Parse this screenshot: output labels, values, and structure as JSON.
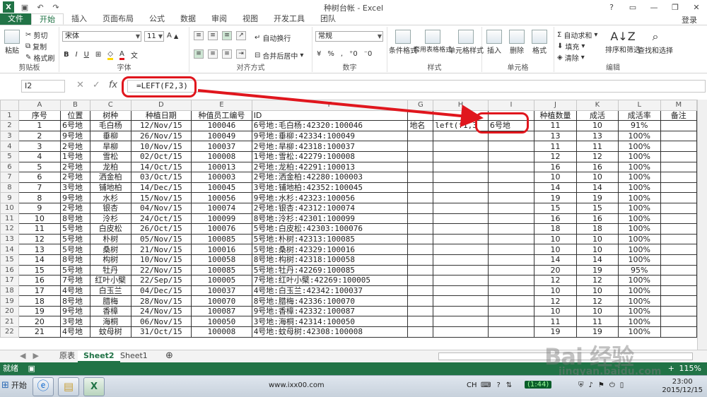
{
  "window": {
    "title": "种树台帐 - Excel",
    "login": "登录",
    "logo": "X"
  },
  "ribbon_tabs": [
    "文件",
    "开始",
    "插入",
    "页面布局",
    "公式",
    "数据",
    "审阅",
    "视图",
    "开发工具",
    "团队"
  ],
  "ribbon": {
    "clipboard": {
      "paste": "粘贴",
      "cut": "剪切",
      "copy": "复制",
      "format_painter": "格式刷",
      "label": "剪贴板"
    },
    "font": {
      "name": "宋体",
      "size": "11",
      "label": "字体"
    },
    "alignment": {
      "wrap": "自动换行",
      "merge": "合并后居中",
      "label": "对齐方式"
    },
    "number": {
      "format": "常规",
      "label": "数字"
    },
    "styles": {
      "conditional": "条件格式",
      "table": "套用表格格式",
      "cell_styles": "单元格样式",
      "label": "样式"
    },
    "cells": {
      "insert": "插入",
      "delete": "删除",
      "format": "格式",
      "label": "单元格"
    },
    "editing": {
      "autosum": "自动求和",
      "fill": "填充",
      "clear": "清除",
      "sort": "排序和筛选",
      "find": "查找和选择",
      "label": "编辑"
    }
  },
  "formula_bar": {
    "name_box": "I2",
    "formula": "=LEFT(F2,3)",
    "fx": "fx"
  },
  "columns": [
    "A",
    "B",
    "C",
    "D",
    "E",
    "F",
    "G",
    "H",
    "I",
    "J",
    "K",
    "L",
    "M"
  ],
  "header_row": [
    "序号",
    "位置",
    "树种",
    "种植日期",
    "种值员工编号",
    "ID",
    "",
    "",
    "",
    "种植数量",
    "成活",
    "成活率",
    "备注"
  ],
  "row2_extra": {
    "g": "地名",
    "h": "left(f1,3",
    "i": "6号地"
  },
  "rows": [
    [
      "1",
      "6号地",
      "毛白杨",
      "12/Nov/15",
      "100046",
      "6号地:毛白杨:42320:100046",
      "11",
      "10",
      "91%"
    ],
    [
      "2",
      "9号地",
      "垂柳",
      "26/Nov/15",
      "100049",
      "9号地:垂柳:42334:100049",
      "13",
      "13",
      "100%"
    ],
    [
      "3",
      "2号地",
      "旱柳",
      "10/Nov/15",
      "100037",
      "2号地:旱柳:42318:100037",
      "11",
      "11",
      "100%"
    ],
    [
      "4",
      "1号地",
      "雪松",
      "02/Oct/15",
      "100008",
      "1号地:雪松:42279:100008",
      "12",
      "12",
      "100%"
    ],
    [
      "5",
      "2号地",
      "龙柏",
      "14/Oct/15",
      "100013",
      "2号地:龙柏:42291:100013",
      "16",
      "16",
      "100%"
    ],
    [
      "6",
      "2号地",
      "洒金柏",
      "03/Oct/15",
      "100003",
      "2号地:洒金柏:42280:100003",
      "10",
      "10",
      "100%"
    ],
    [
      "7",
      "3号地",
      "铺地柏",
      "14/Dec/15",
      "100045",
      "3号地:铺地柏:42352:100045",
      "14",
      "14",
      "100%"
    ],
    [
      "8",
      "9号地",
      "水杉",
      "15/Nov/15",
      "100056",
      "9号地:水杉:42323:100056",
      "19",
      "19",
      "100%"
    ],
    [
      "9",
      "2号地",
      "银杏",
      "04/Nov/15",
      "100074",
      "2号地:银杏:42312:100074",
      "15",
      "15",
      "100%"
    ],
    [
      "10",
      "8号地",
      "泠杉",
      "24/Oct/15",
      "100099",
      "8号地:泠杉:42301:100099",
      "16",
      "16",
      "100%"
    ],
    [
      "11",
      "5号地",
      "白皮松",
      "26/Oct/15",
      "100076",
      "5号地:白皮松:42303:100076",
      "18",
      "18",
      "100%"
    ],
    [
      "12",
      "5号地",
      "朴树",
      "05/Nov/15",
      "100085",
      "5号地:朴树:42313:100085",
      "10",
      "10",
      "100%"
    ],
    [
      "13",
      "5号地",
      "桑树",
      "21/Nov/15",
      "100016",
      "5号地:桑树:42329:100016",
      "10",
      "10",
      "100%"
    ],
    [
      "14",
      "8号地",
      "构树",
      "10/Nov/15",
      "100058",
      "8号地:构树:42318:100058",
      "14",
      "14",
      "100%"
    ],
    [
      "15",
      "5号地",
      "牡丹",
      "22/Nov/15",
      "100085",
      "5号地:牡丹:42269:100085",
      "20",
      "19",
      "95%"
    ],
    [
      "16",
      "7号地",
      "红叶小檗",
      "22/Sep/15",
      "100005",
      "7号地:红叶小檗:42269:100005",
      "12",
      "12",
      "100%"
    ],
    [
      "17",
      "4号地",
      "白玉兰",
      "04/Dec/15",
      "100037",
      "4号地:白玉兰:42342:100037",
      "10",
      "10",
      "100%"
    ],
    [
      "18",
      "8号地",
      "腊梅",
      "28/Nov/15",
      "100070",
      "8号地:腊梅:42336:100070",
      "12",
      "12",
      "100%"
    ],
    [
      "19",
      "9号地",
      "香樟",
      "24/Nov/15",
      "100087",
      "9号地:香樟:42332:100087",
      "10",
      "10",
      "100%"
    ],
    [
      "20",
      "3号地",
      "海桐",
      "06/Nov/15",
      "100050",
      "3号地:海桐:42314:100050",
      "11",
      "11",
      "100%"
    ],
    [
      "21",
      "4号地",
      "蚊母树",
      "31/Oct/15",
      "100008",
      "4号地:蚊母树:42308:100008",
      "19",
      "19",
      "100%"
    ]
  ],
  "sheets": [
    "原表",
    "Sheet2",
    "Sheet1"
  ],
  "active_sheet": "Sheet2",
  "status": {
    "text": "就绪",
    "zoom": "115%"
  },
  "taskbar": {
    "start": "开始",
    "site": "www.ixx00.com",
    "lang": "CH",
    "time": "23:00",
    "date": "2015/12/15",
    "battery": "(1:44)"
  },
  "watermark": {
    "logo": "Bai 经验",
    "url": "jingyan.baidu.com"
  },
  "colors": {
    "excel_green": "#217346",
    "highlight_red": "#e0161d"
  }
}
